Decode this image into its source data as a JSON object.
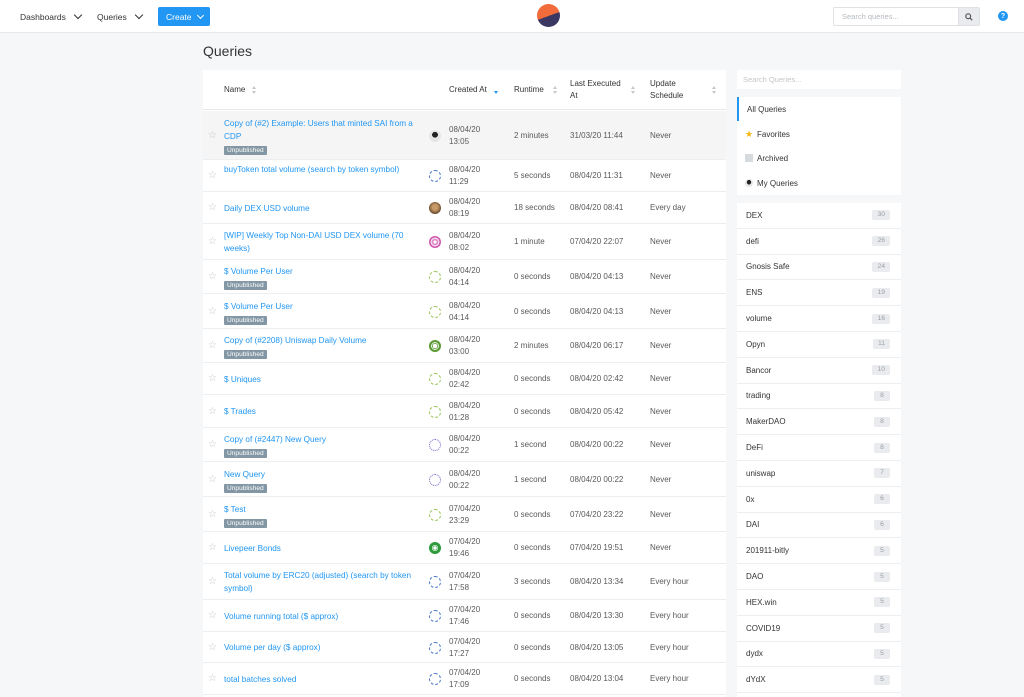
{
  "nav": {
    "dashboards": "Dashboards",
    "queries": "Queries",
    "create": "Create",
    "search_placeholder": "Search queries..."
  },
  "page": {
    "title": "Queries"
  },
  "table": {
    "headers": {
      "name": "Name",
      "created_at": "Created At",
      "runtime": "Runtime",
      "last_executed": "Last Executed At",
      "schedule": "Update Schedule"
    },
    "rows": [
      {
        "name": "Copy of (#2) Example: Users that minted SAI from a CDP",
        "unpublished": "Unpublished",
        "avatar": "photo1",
        "created": "08/04/20 13:05",
        "runtime": "2 minutes",
        "last": "31/03/20 11:44",
        "schedule": "Never"
      },
      {
        "name": "buyToken total volume (search by token symbol)",
        "unpublished": "",
        "avatar": "blue",
        "created": "08/04/20 11:29",
        "runtime": "5 seconds",
        "last": "08/04/20 11:31",
        "schedule": "Never"
      },
      {
        "name": "Daily DEX USD volume",
        "unpublished": "",
        "avatar": "photo2",
        "created": "08/04/20 08:19",
        "runtime": "18 seconds",
        "last": "08/04/20 08:41",
        "schedule": "Every day"
      },
      {
        "name": "[WIP] Weekly Top Non-DAI USD DEX volume (70 weeks)",
        "unpublished": "",
        "avatar": "pink",
        "created": "08/04/20 08:02",
        "runtime": "1 minute",
        "last": "07/04/20 22:07",
        "schedule": "Never"
      },
      {
        "name": "$ Volume Per User",
        "unpublished": "Unpublished",
        "avatar": "gen",
        "created": "08/04/20 04:14",
        "runtime": "0 seconds",
        "last": "08/04/20 04:13",
        "schedule": "Never"
      },
      {
        "name": "$ Volume Per User",
        "unpublished": "Unpublished",
        "avatar": "gen",
        "created": "08/04/20 04:14",
        "runtime": "0 seconds",
        "last": "08/04/20 04:13",
        "schedule": "Never"
      },
      {
        "name": "Copy of (#2208) Uniswap Daily Volume",
        "unpublished": "Unpublished",
        "avatar": "green",
        "created": "08/04/20 03:00",
        "runtime": "2 minutes",
        "last": "08/04/20 06:17",
        "schedule": "Never"
      },
      {
        "name": "$ Uniques",
        "unpublished": "",
        "avatar": "gen",
        "created": "08/04/20 02:42",
        "runtime": "0 seconds",
        "last": "08/04/20 02:42",
        "schedule": "Never"
      },
      {
        "name": "$ Trades",
        "unpublished": "",
        "avatar": "gen",
        "created": "08/04/20 01:28",
        "runtime": "0 seconds",
        "last": "08/04/20 05:42",
        "schedule": "Never"
      },
      {
        "name": "Copy of (#2447) New Query",
        "unpublished": "Unpublished",
        "avatar": "purple",
        "created": "08/04/20 00:22",
        "runtime": "1 second",
        "last": "08/04/20 00:22",
        "schedule": "Never"
      },
      {
        "name": "New Query",
        "unpublished": "Unpublished",
        "avatar": "purple",
        "created": "08/04/20 00:22",
        "runtime": "1 second",
        "last": "08/04/20 00:22",
        "schedule": "Never"
      },
      {
        "name": "$ Test",
        "unpublished": "Unpublished",
        "avatar": "gen",
        "created": "07/04/20 23:29",
        "runtime": "0 seconds",
        "last": "07/04/20 23:22",
        "schedule": "Never"
      },
      {
        "name": "Livepeer Bonds",
        "unpublished": "",
        "avatar": "lime",
        "created": "07/04/20 19:46",
        "runtime": "0 seconds",
        "last": "07/04/20 19:51",
        "schedule": "Never"
      },
      {
        "name": "Total volume by ERC20 (adjusted) (search by token symbol)",
        "unpublished": "",
        "avatar": "blue",
        "created": "07/04/20 17:58",
        "runtime": "3 seconds",
        "last": "08/04/20 13:34",
        "schedule": "Every hour"
      },
      {
        "name": "Volume running total ($ approx)",
        "unpublished": "",
        "avatar": "blue",
        "created": "07/04/20 17:46",
        "runtime": "0 seconds",
        "last": "08/04/20 13:30",
        "schedule": "Every hour"
      },
      {
        "name": "Volume per day ($ approx)",
        "unpublished": "",
        "avatar": "blue",
        "created": "07/04/20 17:27",
        "runtime": "0 seconds",
        "last": "08/04/20 13:05",
        "schedule": "Every hour"
      },
      {
        "name": "total batches solved",
        "unpublished": "",
        "avatar": "blue",
        "created": "07/04/20 17:09",
        "runtime": "0 seconds",
        "last": "08/04/20 13:04",
        "schedule": "Every hour"
      }
    ]
  },
  "sidebar": {
    "search_placeholder": "Search Queries...",
    "filters": [
      {
        "label": "All Queries",
        "icon": "none"
      },
      {
        "label": "Favorites",
        "icon": "star-icon"
      },
      {
        "label": "Archived",
        "icon": "archive-icon"
      },
      {
        "label": "My Queries",
        "icon": "user-icon"
      }
    ],
    "tags": [
      {
        "label": "DEX",
        "count": "30"
      },
      {
        "label": "defi",
        "count": "26"
      },
      {
        "label": "Gnosis Safe",
        "count": "24"
      },
      {
        "label": "ENS",
        "count": "19"
      },
      {
        "label": "volume",
        "count": "16"
      },
      {
        "label": "Opyn",
        "count": "11"
      },
      {
        "label": "Bancor",
        "count": "10"
      },
      {
        "label": "trading",
        "count": "8"
      },
      {
        "label": "MakerDAO",
        "count": "8"
      },
      {
        "label": "DeFi",
        "count": "8"
      },
      {
        "label": "uniswap",
        "count": "7"
      },
      {
        "label": "0x",
        "count": "6"
      },
      {
        "label": "DAI",
        "count": "6"
      },
      {
        "label": "201911-bitly",
        "count": "5"
      },
      {
        "label": "DAO",
        "count": "5"
      },
      {
        "label": "HEX.win",
        "count": "5"
      },
      {
        "label": "COVID19",
        "count": "5"
      },
      {
        "label": "dydx",
        "count": "5"
      },
      {
        "label": "dYdX",
        "count": "5"
      }
    ]
  },
  "colors": {
    "accent": "#2196f3",
    "badge": "#8296a3"
  }
}
